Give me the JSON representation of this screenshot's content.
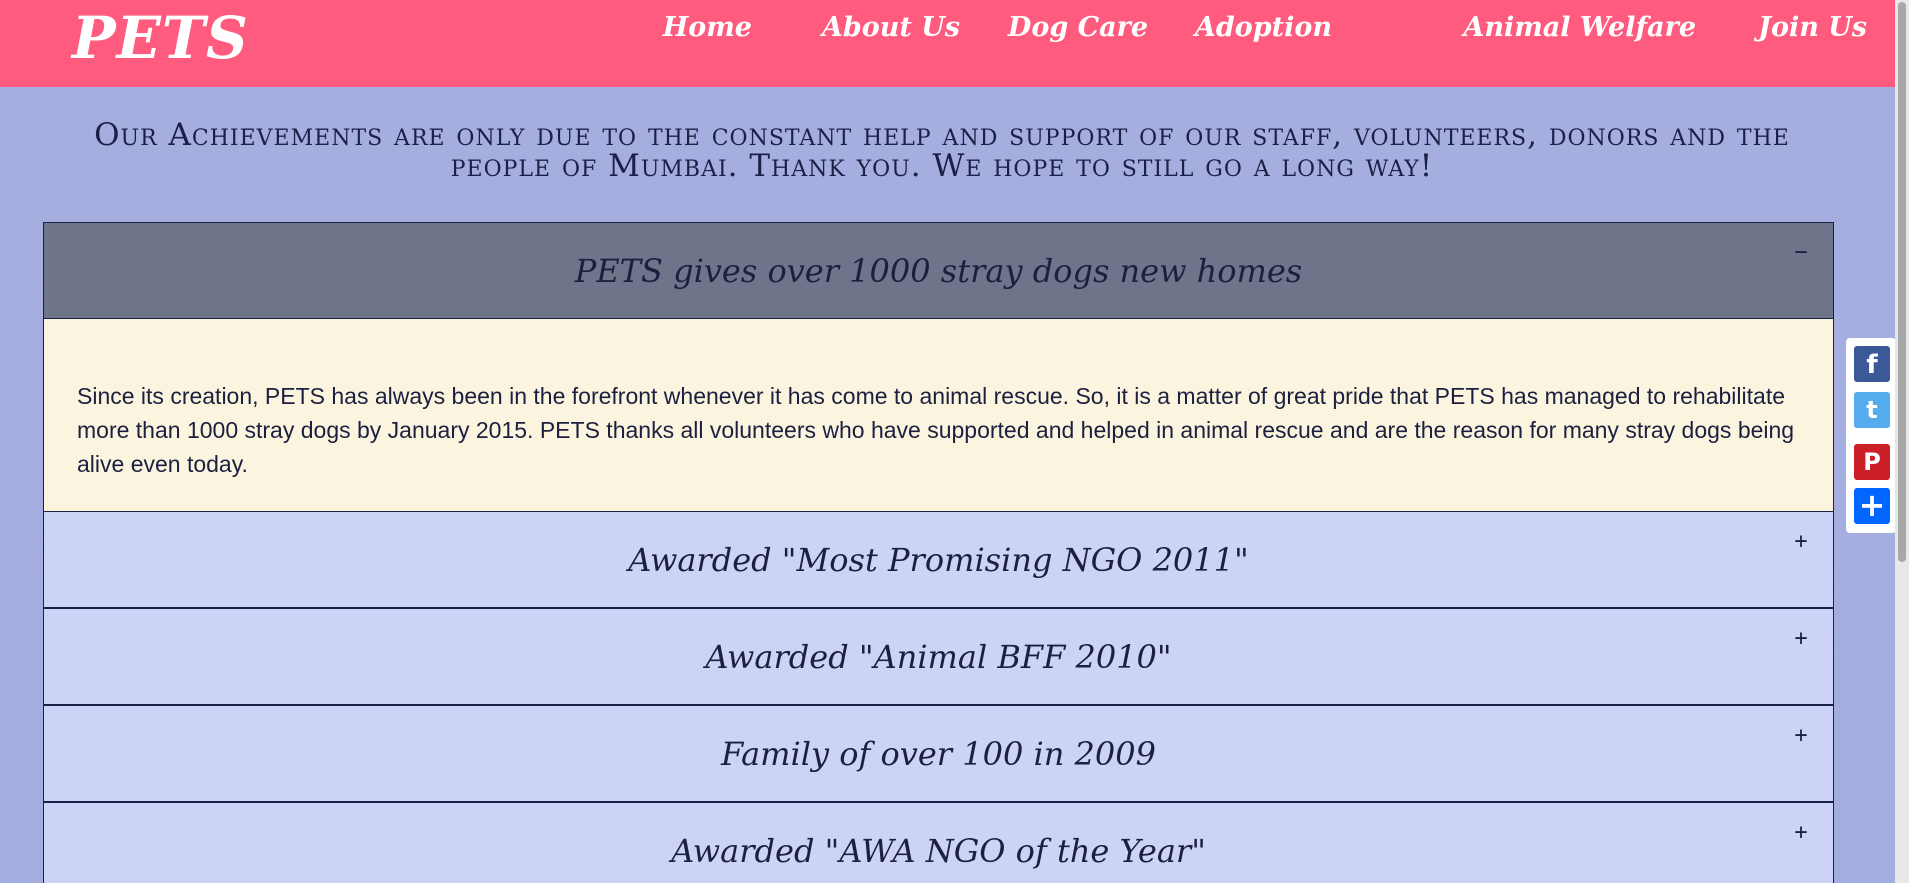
{
  "brand": "PETS",
  "nav": [
    "Home",
    "About Us",
    "Dog Care",
    "Adoption",
    "Animal Welfare",
    "Join Us"
  ],
  "intro": "Our Achievements are only due to the constant help and support of our staff, volunteers, donors and the people of Mumbai. Thank you. We hope to still go a long way!",
  "accordion": [
    {
      "title": "PETS gives over 1000 stray dogs new homes",
      "toggle": "−",
      "body": "Since its creation, PETS has always been in the forefront whenever it has come to animal rescue. So, it is a matter of great pride that PETS has managed to rehabilitate more than 1000 stray dogs by January 2015. PETS thanks all volunteers who have supported and helped in animal rescue and are the reason for many stray dogs being alive even today."
    },
    {
      "title": "Awarded \"Most Promising NGO 2011\"",
      "toggle": "+"
    },
    {
      "title": "Awarded \"Animal BFF 2010\"",
      "toggle": "+"
    },
    {
      "title": "Family of over 100 in 2009",
      "toggle": "+"
    },
    {
      "title": "Awarded \"AWA NGO of the Year\"",
      "toggle": "+"
    }
  ],
  "share": [
    {
      "icon": "facebook-icon",
      "glyph": "f",
      "color": "#3b5998"
    },
    {
      "icon": "twitter-icon",
      "glyph": "t",
      "color": "#55acee"
    },
    {
      "icon": "pinterest-icon",
      "glyph": "P",
      "color": "#cb2027"
    },
    {
      "icon": "share-icon",
      "glyph": "+",
      "color": "#0166ff"
    }
  ],
  "colors": {
    "navbar": "#ff5b7f",
    "background": "#a6aee0",
    "panel_closed": "#cdd3f7",
    "panel_open": "#6e7489",
    "panel_body": "#fbf4de"
  }
}
